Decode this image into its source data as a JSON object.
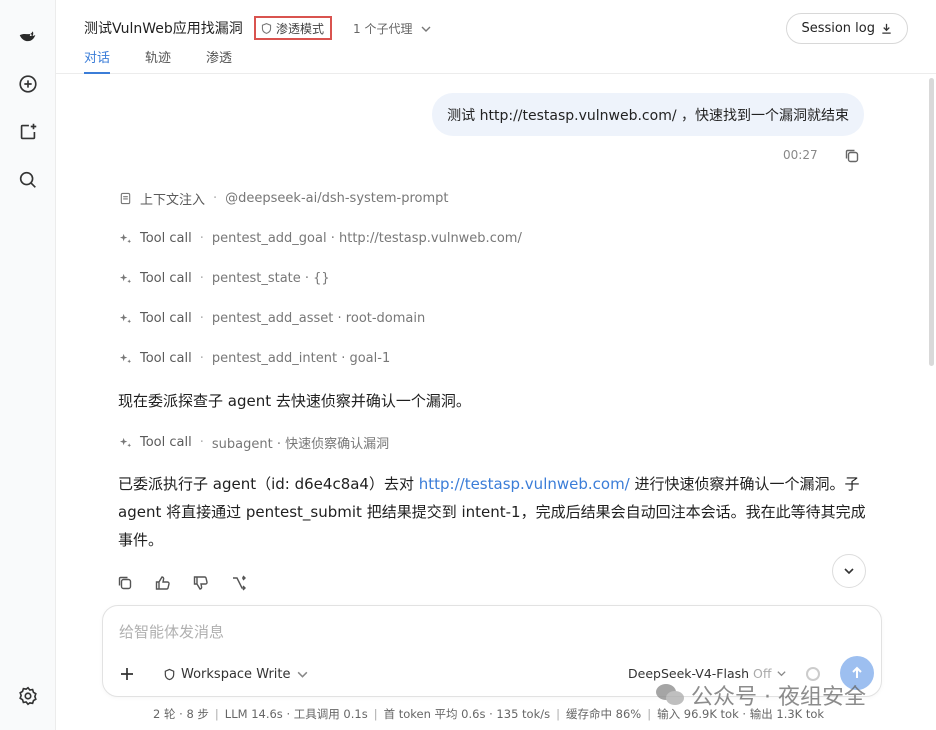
{
  "header": {
    "title": "测试VulnWeb应用找漏洞",
    "mode_badge": "渗透模式",
    "agents_label": "1 个子代理",
    "session_log_label": "Session log",
    "tabs": [
      "对话",
      "轨迹",
      "渗透"
    ]
  },
  "conversation": {
    "user_message": "测试  http://testasp.vulnweb.com/ ，快速找到一个漏洞就结束",
    "user_time": "00:27",
    "steps": [
      {
        "kind": "上下文注入",
        "detail": "@deepseek-ai/dsh-system-prompt",
        "icon": "document-icon"
      },
      {
        "kind": "Tool call",
        "detail": "pentest_add_goal · http://testasp.vulnweb.com/",
        "icon": "sparkle-icon"
      },
      {
        "kind": "Tool call",
        "detail": "pentest_state · {}",
        "icon": "sparkle-icon"
      },
      {
        "kind": "Tool call",
        "detail": "pentest_add_asset · root-domain",
        "icon": "sparkle-icon"
      },
      {
        "kind": "Tool call",
        "detail": "pentest_add_intent · goal-1",
        "icon": "sparkle-icon"
      }
    ],
    "para1": "现在委派探查子 agent 去快速侦察并确认一个漏洞。",
    "step_subagent": {
      "kind": "Tool call",
      "detail": "subagent · 快速侦察确认漏洞"
    },
    "para2_prefix": "已委派执行子 agent（id: d6e4c8a4）去对 ",
    "para2_link": "http://testasp.vulnweb.com/",
    "para2_suffix": " 进行快速侦察并确认一个漏洞。子 agent 将直接通过 pentest_submit 把结果提交到 intent-1，完成后结果会自动回注本会话。我在此等待其完成事件。"
  },
  "composer": {
    "placeholder": "给智能体发消息",
    "workspace_label": "Workspace Write",
    "model_label": "DeepSeek-V4-Flash",
    "model_state": "Off"
  },
  "stats": {
    "rounds": "2 轮 · 8 步",
    "llm": "LLM 14.6s · 工具调用 0.1s",
    "first_token": "首 token 平均 0.6s · 135 tok/s",
    "cache": "缓存命中 86%",
    "io": "输入 96.9K tok · 输出 1.3K tok"
  },
  "watermark": "公众号 · 夜组安全",
  "colors": {
    "accent": "#3b7dd8",
    "badge_border": "#d9534f",
    "user_bubble": "#eef3fb"
  }
}
